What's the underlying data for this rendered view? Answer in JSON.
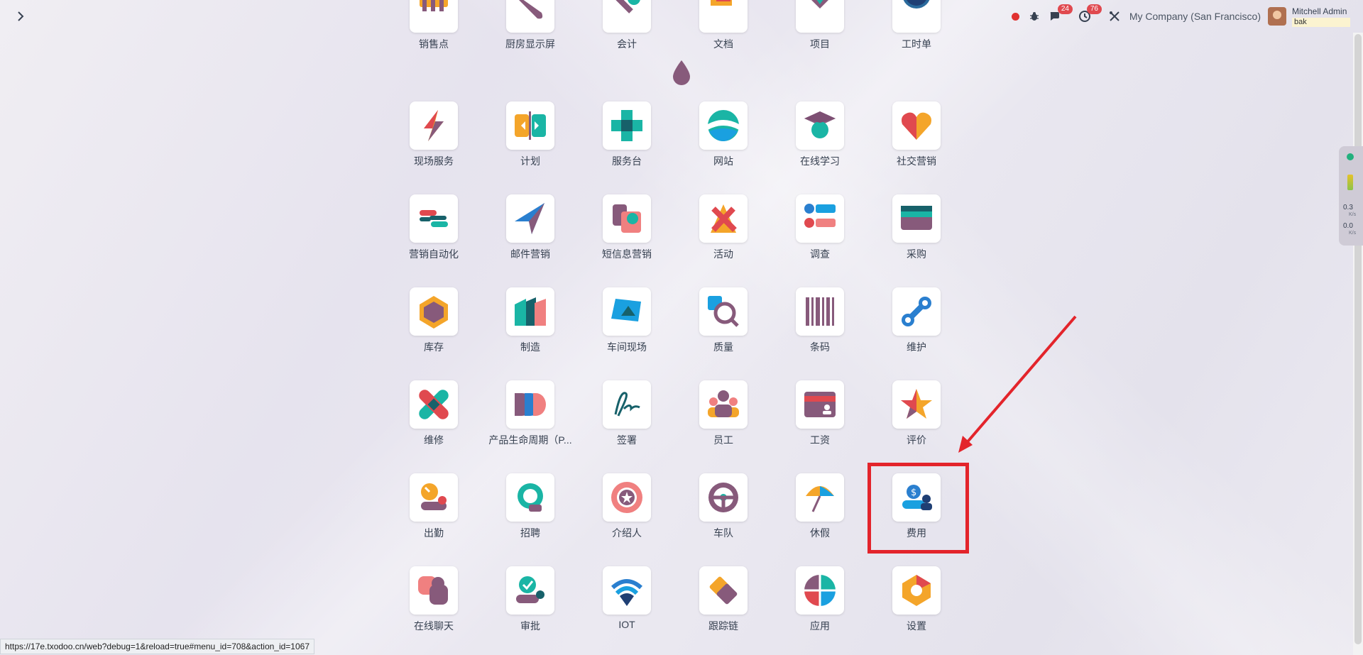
{
  "topbar": {
    "menu_icon": "chevron-right-icon",
    "messages_count": "24",
    "activities_count": "76",
    "company": "My Company (San Francisco)",
    "user_name": "Mitchell Admin",
    "database": "bak"
  },
  "apps": [
    {
      "label": "销售点",
      "icon": "pos"
    },
    {
      "label": "厨房显示屏",
      "icon": "kitchen"
    },
    {
      "label": "会计",
      "icon": "accounting"
    },
    {
      "label": "文档",
      "icon": "documents"
    },
    {
      "label": "项目",
      "icon": "project"
    },
    {
      "label": "工时单",
      "icon": "timesheet"
    },
    {
      "label": "现场服务",
      "icon": "field-service"
    },
    {
      "label": "计划",
      "icon": "planning"
    },
    {
      "label": "服务台",
      "icon": "helpdesk"
    },
    {
      "label": "网站",
      "icon": "website"
    },
    {
      "label": "在线学习",
      "icon": "elearning"
    },
    {
      "label": "社交营销",
      "icon": "social"
    },
    {
      "label": "营销自动化",
      "icon": "marketing-automation"
    },
    {
      "label": "邮件营销",
      "icon": "email-marketing"
    },
    {
      "label": "短信息营销",
      "icon": "sms"
    },
    {
      "label": "活动",
      "icon": "events"
    },
    {
      "label": "调查",
      "icon": "survey"
    },
    {
      "label": "采购",
      "icon": "purchase"
    },
    {
      "label": "库存",
      "icon": "inventory"
    },
    {
      "label": "制造",
      "icon": "manufacturing"
    },
    {
      "label": "车间现场",
      "icon": "shop-floor"
    },
    {
      "label": "质量",
      "icon": "quality"
    },
    {
      "label": "条码",
      "icon": "barcode"
    },
    {
      "label": "维护",
      "icon": "maintenance"
    },
    {
      "label": "维修",
      "icon": "repair"
    },
    {
      "label": "产品生命周期（P...",
      "icon": "plm"
    },
    {
      "label": "签署",
      "icon": "sign"
    },
    {
      "label": "员工",
      "icon": "employees"
    },
    {
      "label": "工资",
      "icon": "payroll"
    },
    {
      "label": "评价",
      "icon": "appraisal"
    },
    {
      "label": "出勤",
      "icon": "attendance"
    },
    {
      "label": "招聘",
      "icon": "recruitment"
    },
    {
      "label": "介绍人",
      "icon": "referral"
    },
    {
      "label": "车队",
      "icon": "fleet"
    },
    {
      "label": "休假",
      "icon": "time-off"
    },
    {
      "label": "费用",
      "icon": "expenses"
    },
    {
      "label": "在线聊天",
      "icon": "live-chat"
    },
    {
      "label": "审批",
      "icon": "approvals"
    },
    {
      "label": "IOT",
      "icon": "iot"
    },
    {
      "label": "跟踪链",
      "icon": "tracking-link"
    },
    {
      "label": "应用",
      "icon": "apps"
    },
    {
      "label": "设置",
      "icon": "settings"
    }
  ],
  "side_monitor": {
    "upload": "0.3",
    "download": "0.0",
    "unit": "K/s"
  },
  "status_url": "https://17e.txodoo.cn/web?debug=1&reload=true#menu_id=708&action_id=1067",
  "colors": {
    "highlight": "#e3242b",
    "badge": "#e0494f",
    "record": "#e03131"
  }
}
